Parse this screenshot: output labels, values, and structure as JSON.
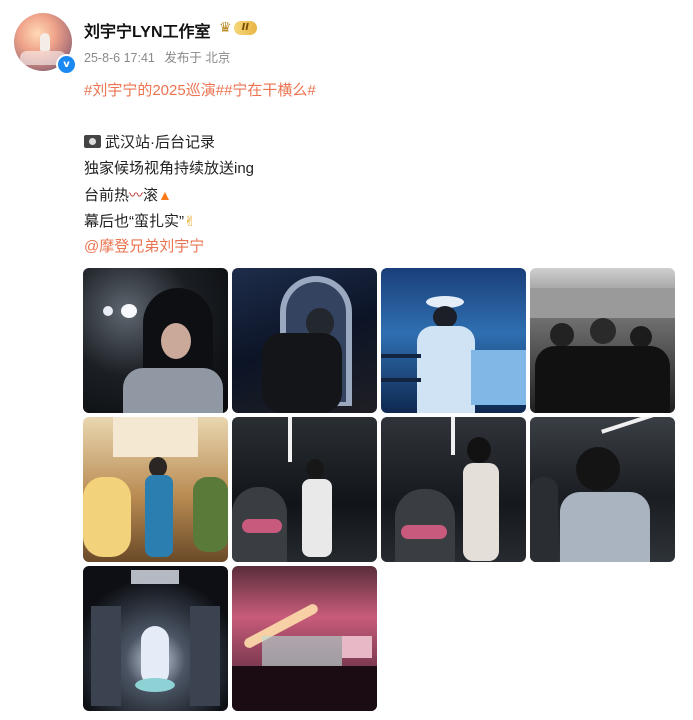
{
  "post": {
    "author": {
      "name": "刘宇宁LYN工作室",
      "vip_level": "II",
      "verified_mark": "v"
    },
    "meta": {
      "timestamp": "25-8-6 17:41",
      "location": "发布于 北京"
    },
    "hashtags": [
      "#刘宇宁的2025巡演#",
      "#宁在干横么#"
    ],
    "lines": {
      "line1": "武汉站·后台记录",
      "line2": "独家候场视角持续放送ing",
      "line3_a": "台前热",
      "line3_b": "滚",
      "line4_a": "幕后也“蛮扎实”"
    },
    "mention": "@摩登兄弟刘宇宁",
    "icons": [
      "crown-icon",
      "camera-icon",
      "chili-icon",
      "fire-icon",
      "thumbs-up-icon",
      "verified-icon"
    ],
    "photo_count": 10,
    "colors": {
      "link": "#eb7350",
      "verified": "#1b89f2",
      "vip": "#e9b544"
    }
  }
}
